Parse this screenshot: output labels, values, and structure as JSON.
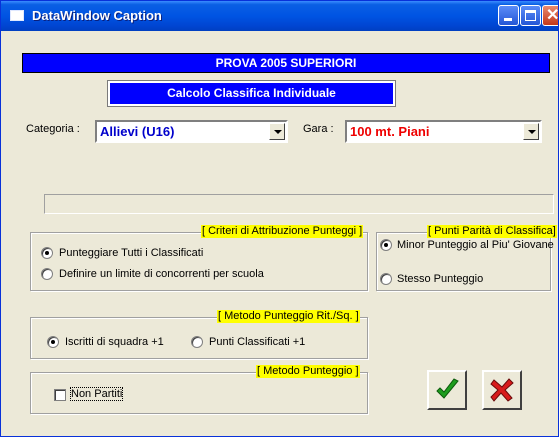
{
  "window": {
    "title": "DataWindow Caption"
  },
  "header": {
    "banner": "PROVA 2005 SUPERIORI",
    "subbanner": "Calcolo Classifica Individuale"
  },
  "filters": {
    "categoria_label": "Categoria :",
    "categoria_value": "Allievi (U16)",
    "categoria_color": "#0000cc",
    "gara_label": "Gara :",
    "gara_value": "100 mt. Piani",
    "gara_color": "#ee0000"
  },
  "criteri": {
    "title": "[ Criteri di Attribuzione Punteggi ]",
    "options": [
      "Punteggiare Tutti i Classificati",
      "Definire un limite di concorrenti per scuola"
    ],
    "selected": 0
  },
  "parita": {
    "title": "[ Punti Parità di Classifica]",
    "options": [
      "Minor Punteggio al Piu' Giovane",
      "Stesso Punteggio"
    ],
    "selected": 0
  },
  "metodo_rit": {
    "title": "[ Metodo Punteggio Rit./Sq. ]",
    "options": [
      "Iscritti di squadra +1",
      "Punti Classificati +1"
    ],
    "selected": 0
  },
  "metodo": {
    "title": "[ Metodo Punteggio ]",
    "checkbox_label": "Non Partiti",
    "checked": false
  },
  "buttons": {
    "ok_icon": "green-checkmark-icon",
    "cancel_icon": "red-x-icon"
  },
  "colors": {
    "title_bar": "#0054e3",
    "banner_bg": "#0000ff",
    "group_title_bg": "#ffff00"
  }
}
